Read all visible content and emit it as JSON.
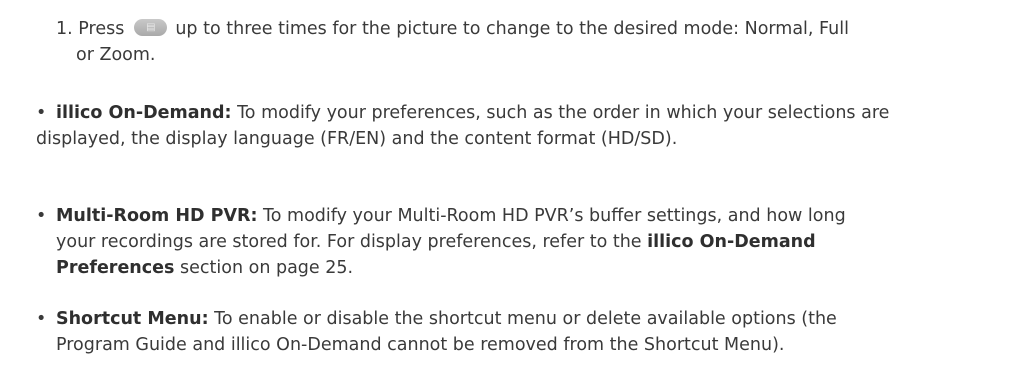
{
  "step1": {
    "number": "1.",
    "before_icon": "Press",
    "icon": "aspect-key-icon",
    "after_icon": "up to three times for the picture to change to the desired mode: Normal, Full",
    "continuation": "or Zoom."
  },
  "bullets": [
    {
      "term": "illico On-Demand:",
      "line1": "To modify your preferences, such as the order in which your selections are",
      "line2": "displayed, the display language (FR/EN) and the content format (HD/SD)."
    },
    {
      "term": "Multi-Room HD PVR:",
      "line1": "To modify your Multi-Room HD PVR’s buffer settings, and how long",
      "line2a": "your recordings are stored for. For display preferences, refer to the",
      "line2_bold": "illico On-Demand",
      "line3_bold": "Preferences",
      "line3": "section on page 25."
    },
    {
      "term": "Shortcut Menu:",
      "line1": "To enable or disable the shortcut menu or delete available options (the",
      "line2": "Program Guide and illico On-Demand cannot be removed from the Shortcut Menu)."
    }
  ],
  "bullet_glyph": "•"
}
